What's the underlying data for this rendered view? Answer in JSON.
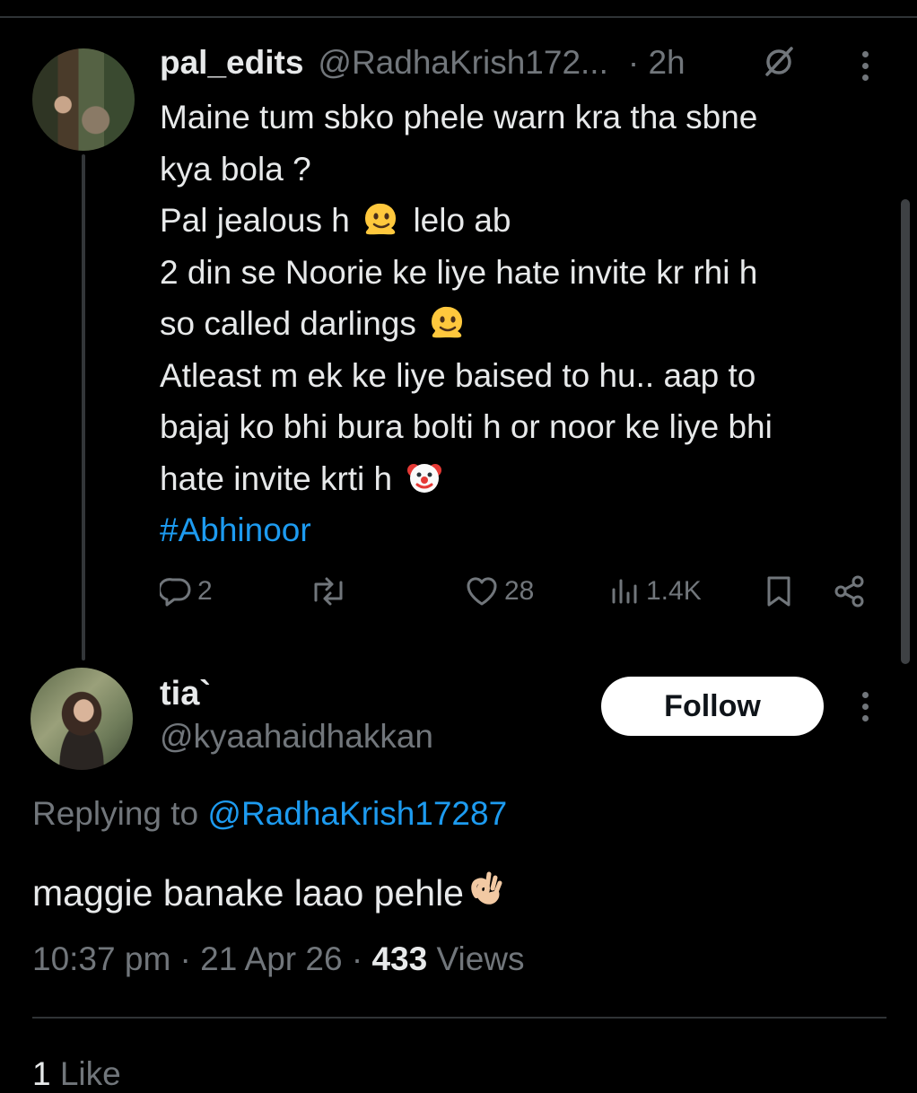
{
  "tweet1": {
    "display_name": "pal_edits",
    "handle": "@RadhaKrish172...",
    "time": "· 2h",
    "lines": [
      "Maine tum sbko phele warn kra tha sbne",
      "kya bola ?",
      "Pal jealous h",
      "lelo ab",
      "2 din se Noorie ke liye hate invite kr rhi h",
      "so called darlings",
      "Atleast m ek ke liye baised to hu.. aap to",
      "bajaj ko bhi bura bolti h or noor ke liye bhi",
      "hate invite krti h"
    ],
    "hashtag": "#Abhinoor",
    "replies": "2",
    "likes": "28",
    "views": "1.4K"
  },
  "tweet2": {
    "display_name": "tia`",
    "handle": "@kyaahaidhakkan",
    "follow_label": "Follow",
    "replying_prefix": "Replying to",
    "replying_to": "@RadhaKrish17287",
    "text": "maggie banake laao pehle",
    "timestamp": "10:37 pm · 21 Apr 26 ·",
    "views_count": "433",
    "views_label": "Views",
    "likes_count": "1",
    "likes_label": "Like"
  },
  "colors": {
    "background": "#000000",
    "text": "#e7e9ea",
    "muted": "#71767b",
    "link": "#1d9bf0"
  },
  "icons": [
    "grok-icon",
    "more-icon",
    "reply-icon",
    "retweet-icon",
    "like-icon",
    "views-icon",
    "bookmark-icon",
    "share-icon"
  ]
}
